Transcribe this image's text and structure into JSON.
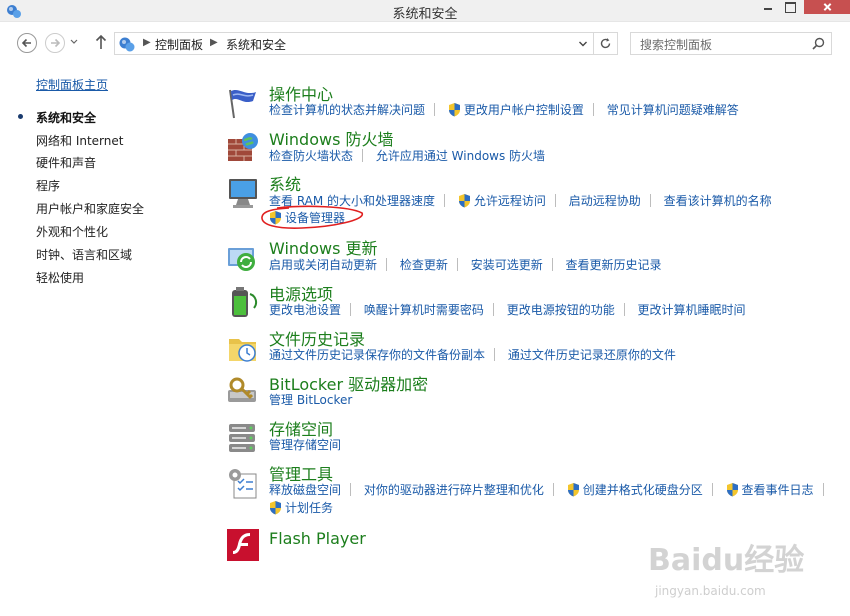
{
  "window": {
    "title": "系统和安全"
  },
  "address": {
    "breadcrumbs": [
      "控制面板",
      "系统和安全"
    ],
    "search_placeholder": "搜索控制面板"
  },
  "sidebar": {
    "home": "控制面板主页",
    "items": [
      "系统和安全",
      "网络和 Internet",
      "硬件和声音",
      "程序",
      "用户帐户和家庭安全",
      "外观和个性化",
      "时钟、语言和区域",
      "轻松使用"
    ]
  },
  "categories": [
    {
      "title": "操作中心",
      "rows": [
        [
          "检查计算机的状态并解决问题",
          "更改用户帐户控制设置",
          "常见计算机问题疑难解答"
        ]
      ]
    },
    {
      "title": "Windows 防火墙",
      "rows": [
        [
          "检查防火墙状态",
          "允许应用通过 Windows 防火墙"
        ]
      ]
    },
    {
      "title": "系统",
      "rows": [
        [
          "查看 RAM 的大小和处理器速度",
          "允许远程访问",
          "启动远程协助",
          "查看该计算机的名称"
        ],
        [
          "设备管理器"
        ]
      ]
    },
    {
      "title": "Windows 更新",
      "rows": [
        [
          "启用或关闭自动更新",
          "检查更新",
          "安装可选更新",
          "查看更新历史记录"
        ]
      ]
    },
    {
      "title": "电源选项",
      "rows": [
        [
          "更改电池设置",
          "唤醒计算机时需要密码",
          "更改电源按钮的功能",
          "更改计算机睡眠时间"
        ]
      ]
    },
    {
      "title": "文件历史记录",
      "rows": [
        [
          "通过文件历史记录保存你的文件备份副本",
          "通过文件历史记录还原你的文件"
        ]
      ]
    },
    {
      "title": "BitLocker 驱动器加密",
      "rows": [
        [
          "管理 BitLocker"
        ]
      ]
    },
    {
      "title": "存储空间",
      "rows": [
        [
          "管理存储空间"
        ]
      ]
    },
    {
      "title": "管理工具",
      "rows": [
        [
          "释放磁盘空间",
          "对你的驱动器进行碎片整理和优化",
          "创建并格式化硬盘分区",
          "查看事件日志"
        ],
        [
          "计划任务"
        ]
      ]
    },
    {
      "title": "Flash Player",
      "rows": []
    }
  ],
  "watermark": {
    "brand": "Baidu经验",
    "url": "jingyan.baidu.com"
  },
  "colors": {
    "link": "#1a5aa8",
    "category_title": "#1c7e1c",
    "annotation": "#e02020"
  }
}
